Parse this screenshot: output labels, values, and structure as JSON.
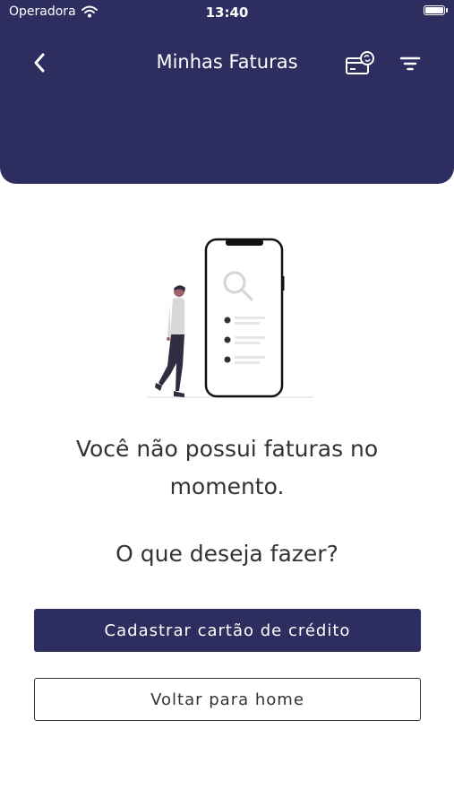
{
  "status_bar": {
    "carrier": "Operadora",
    "time": "13:40",
    "icons": [
      "wifi-icon",
      "battery-icon"
    ]
  },
  "nav": {
    "title": "Minhas Faturas",
    "icons": [
      "back-arrow-icon",
      "credit-card-refresh-icon",
      "filter-icon"
    ]
  },
  "empty_state": {
    "message": "Você não possui faturas no momento.",
    "question": "O que deseja fazer?",
    "illustration": "person-next-to-phone-search-illustration"
  },
  "actions": {
    "primary_label": "Cadastrar cartão de crédito",
    "secondary_label": "Voltar para home"
  },
  "colors": {
    "brand": "#2d2d5f",
    "text": "#333333",
    "background": "#ffffff"
  }
}
